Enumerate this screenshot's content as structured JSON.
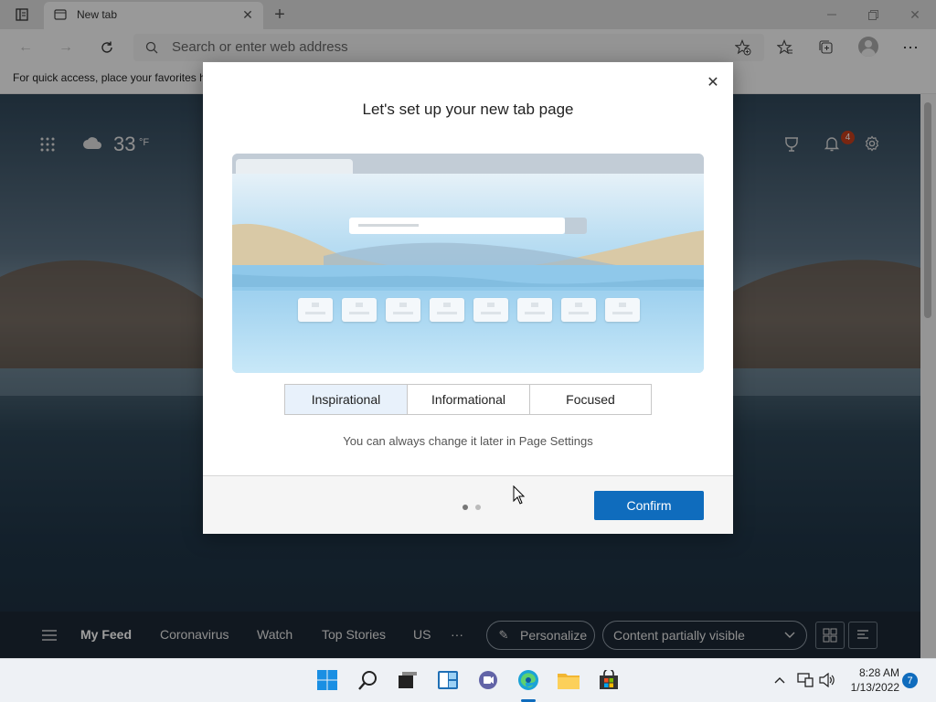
{
  "browser": {
    "tab_title": "New tab",
    "address_placeholder": "Search or enter web address",
    "favorites_bar_text": "For quick access, place your favorites h"
  },
  "newtab": {
    "weather_temp": "33",
    "weather_unit": "°F",
    "notification_count": "4"
  },
  "dialog": {
    "title": "Let's set up your new tab page",
    "options": [
      "Inspirational",
      "Informational",
      "Focused"
    ],
    "selected_option": "Inspirational",
    "hint": "You can always change it later in Page Settings",
    "confirm_label": "Confirm",
    "page_indicator": {
      "current": 1,
      "total": 2
    }
  },
  "feed": {
    "items": [
      "My Feed",
      "Coronavirus",
      "Watch",
      "Top Stories",
      "US"
    ],
    "more": "···",
    "personalize_label": "Personalize",
    "visibility_label": "Content partially visible"
  },
  "taskbar": {
    "time": "8:28 AM",
    "date": "1/13/2022",
    "notification_count": "7"
  },
  "colors": {
    "accent": "#0f6cbd",
    "selected_segment": "#e8f1fb",
    "notification_badge": "#c43e1c"
  }
}
